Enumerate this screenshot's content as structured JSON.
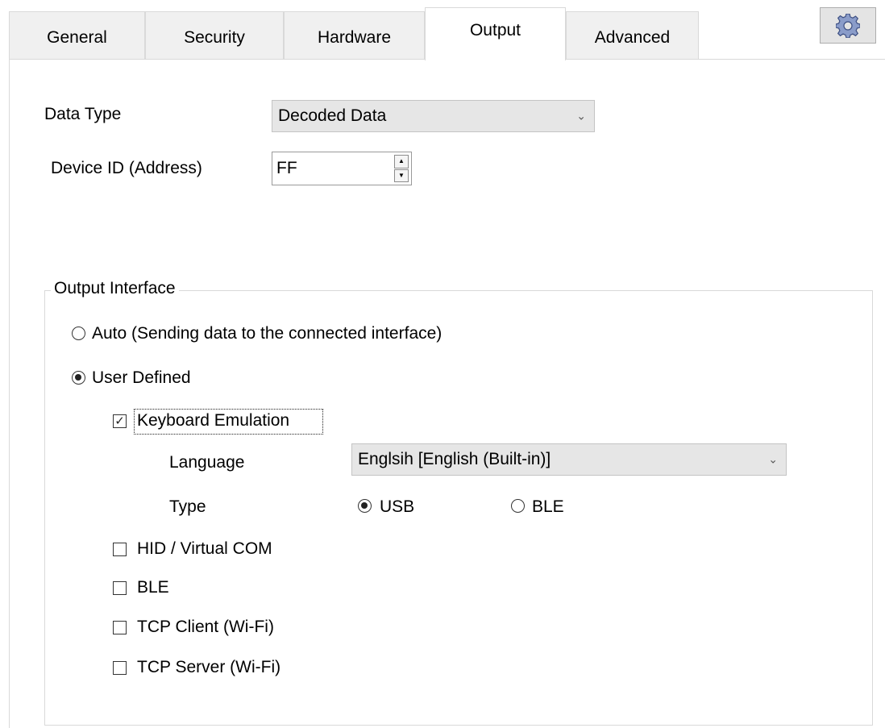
{
  "tabs": [
    {
      "label": "General"
    },
    {
      "label": "Security"
    },
    {
      "label": "Hardware"
    },
    {
      "label": "Output"
    },
    {
      "label": "Advanced"
    }
  ],
  "active_tab": "Output",
  "settings_icon": "gear-icon",
  "data_type": {
    "label": "Data Type",
    "value": "Decoded Data"
  },
  "device_id": {
    "label": "Device ID (Address)",
    "value": "FF"
  },
  "output_interface": {
    "title": "Output Interface",
    "auto_label": "Auto (Sending data to the connected interface)",
    "auto_selected": false,
    "user_defined_label": "User Defined",
    "user_defined_selected": true,
    "keyboard_emulation": {
      "label": "Keyboard Emulation",
      "checked": true,
      "language_label": "Language",
      "language_value": "Englsih [English (Built-in)]",
      "type_label": "Type",
      "type_options": [
        {
          "label": "USB",
          "selected": true
        },
        {
          "label": "BLE",
          "selected": false
        }
      ]
    },
    "interfaces": [
      {
        "label": "HID / Virtual COM",
        "checked": false
      },
      {
        "label": "BLE",
        "checked": false
      },
      {
        "label": "TCP Client (Wi-Fi)",
        "checked": false
      },
      {
        "label": "TCP Server (Wi-Fi)",
        "checked": false
      }
    ]
  },
  "colors": {
    "tab_inactive_bg": "#f0f0f0",
    "combo_bg": "#e6e6e6",
    "border": "#d9d9d9"
  }
}
